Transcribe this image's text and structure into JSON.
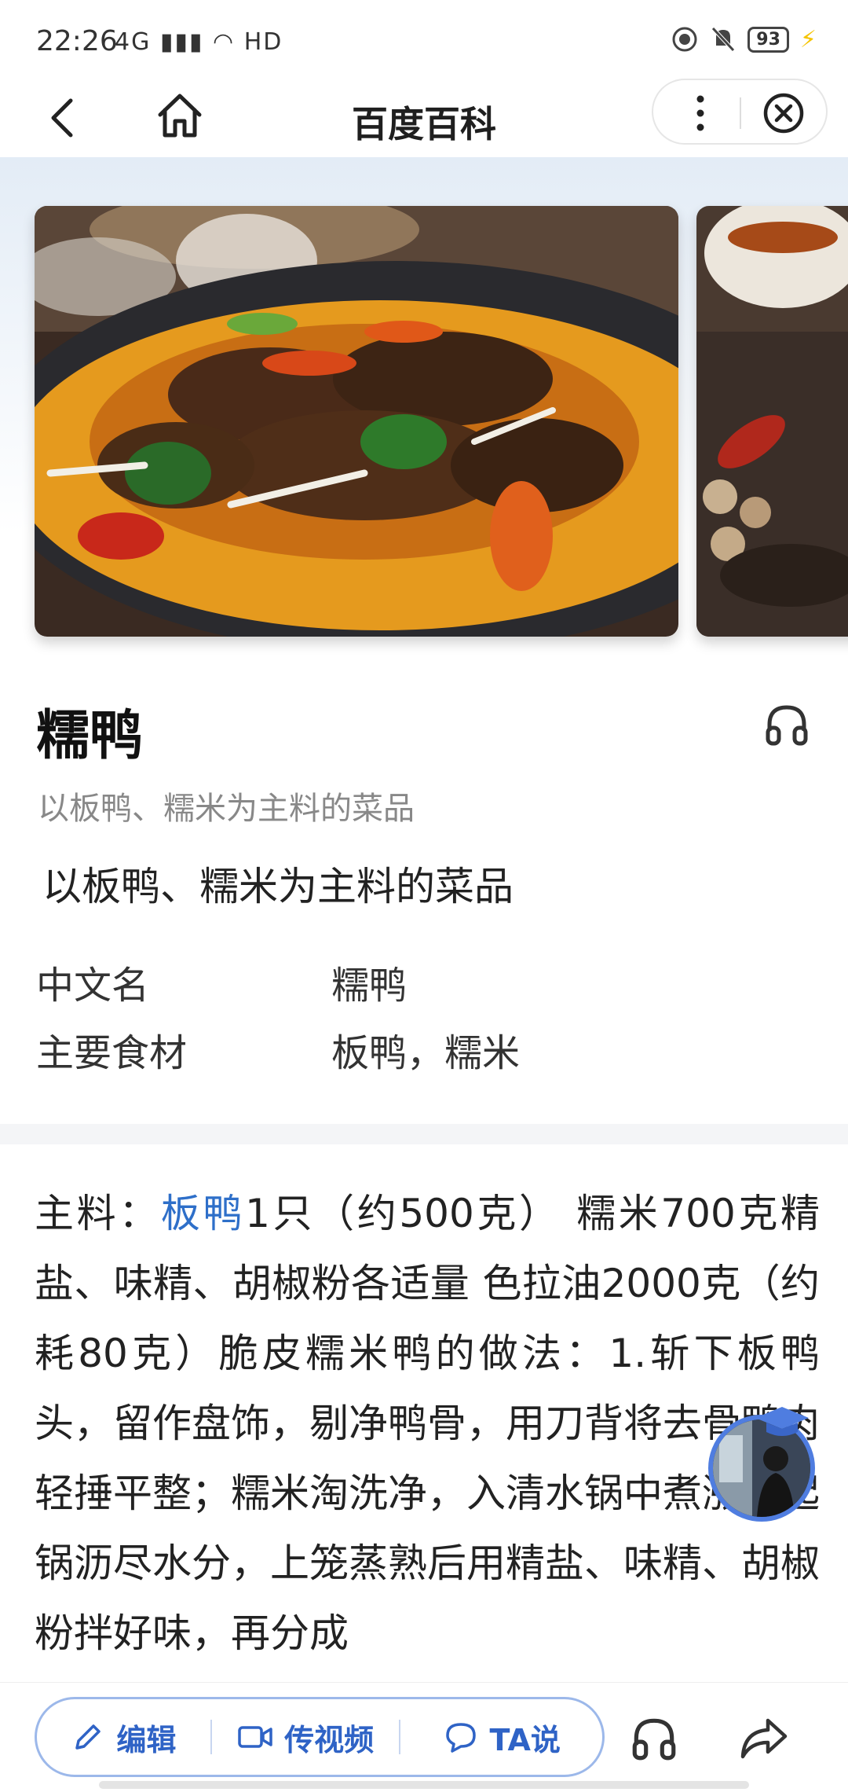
{
  "status_bar": {
    "time": "22:26",
    "network": "4G",
    "wifi_label": "HD",
    "battery": "93"
  },
  "nav": {
    "title": "百度百科"
  },
  "entry": {
    "title": "糯鸭",
    "subtitle": "以板鸭、糯米为主料的菜品",
    "summary": "以板鸭、糯米为主料的菜品",
    "info": [
      {
        "key": "中文名",
        "value": "糯鸭"
      },
      {
        "key": "主要食材",
        "value": "板鸭，糯米"
      }
    ],
    "body": {
      "prefix": "主料：",
      "link": "板鸭",
      "text": "1只（约500克） 糯米700克精盐、味精、胡椒粉各适量 色拉油2000克（约耗80克）脆皮糯米鸭的做法：1.斩下板鸭头，留作盘饰，剔净鸭骨，用刀背将去骨鸭肉轻捶平整；糯米淘洗净，入清水锅中煮涨，起锅沥尽水分，上笼蒸熟后用精盐、味精、胡椒粉拌好味，再分成"
    }
  },
  "toolbar": {
    "edit": "编辑",
    "video": "传视频",
    "ta": "TA说"
  },
  "icons": {
    "back": "chevron-left-icon",
    "home": "home-icon",
    "more": "more-vertical-icon",
    "close": "close-circle-icon",
    "listen": "headphones-icon",
    "share": "share-icon",
    "edit": "pencil-icon",
    "video": "video-icon",
    "comment": "chat-bubble-icon"
  },
  "colors": {
    "link": "#2e6fc9",
    "toolbar_accent": "#2f63c6"
  }
}
